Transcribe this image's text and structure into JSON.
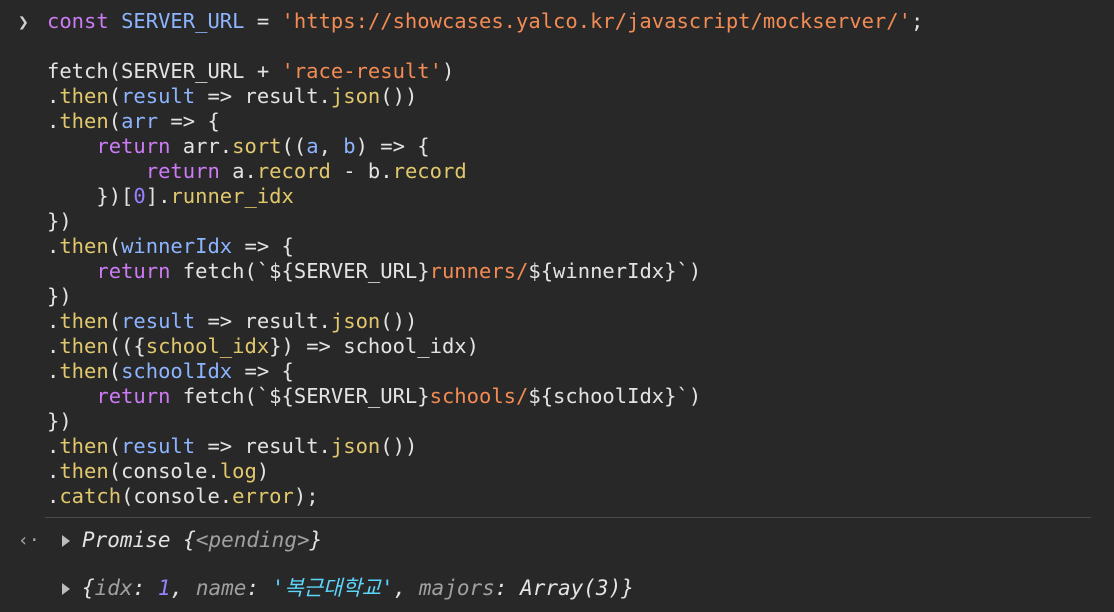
{
  "console": {
    "prompt_icon": "chevron-right-icon",
    "code_lines": [
      [
        {
          "t": "const",
          "c": "kw"
        },
        {
          "t": " ",
          "c": "plain"
        },
        {
          "t": "SERVER_URL",
          "c": "var"
        },
        {
          "t": " = ",
          "c": "plain"
        },
        {
          "t": "'https://showcases.yalco.kr/javascript/mockserver/'",
          "c": "str"
        },
        {
          "t": ";",
          "c": "plain"
        }
      ],
      [],
      [
        {
          "t": "fetch(SERVER_URL + ",
          "c": "plain"
        },
        {
          "t": "'race-result'",
          "c": "str"
        },
        {
          "t": ")",
          "c": "plain"
        }
      ],
      [
        {
          "t": ".",
          "c": "plain"
        },
        {
          "t": "then",
          "c": "fn"
        },
        {
          "t": "(",
          "c": "plain"
        },
        {
          "t": "result",
          "c": "param"
        },
        {
          "t": " => result.",
          "c": "plain"
        },
        {
          "t": "json",
          "c": "fn"
        },
        {
          "t": "())",
          "c": "plain"
        }
      ],
      [
        {
          "t": ".",
          "c": "plain"
        },
        {
          "t": "then",
          "c": "fn"
        },
        {
          "t": "(",
          "c": "plain"
        },
        {
          "t": "arr",
          "c": "param"
        },
        {
          "t": " => {",
          "c": "plain"
        }
      ],
      [
        {
          "t": "    ",
          "c": "plain"
        },
        {
          "t": "return",
          "c": "kw"
        },
        {
          "t": " arr.",
          "c": "plain"
        },
        {
          "t": "sort",
          "c": "fn"
        },
        {
          "t": "((",
          "c": "plain"
        },
        {
          "t": "a",
          "c": "param"
        },
        {
          "t": ", ",
          "c": "plain"
        },
        {
          "t": "b",
          "c": "param"
        },
        {
          "t": ") => {",
          "c": "plain"
        }
      ],
      [
        {
          "t": "        ",
          "c": "plain"
        },
        {
          "t": "return",
          "c": "kw"
        },
        {
          "t": " a.",
          "c": "plain"
        },
        {
          "t": "record",
          "c": "fn"
        },
        {
          "t": " - b.",
          "c": "plain"
        },
        {
          "t": "record",
          "c": "fn"
        }
      ],
      [
        {
          "t": "    })[",
          "c": "plain"
        },
        {
          "t": "0",
          "c": "num"
        },
        {
          "t": "].",
          "c": "plain"
        },
        {
          "t": "runner_idx",
          "c": "fn"
        }
      ],
      [
        {
          "t": "})",
          "c": "plain"
        }
      ],
      [
        {
          "t": ".",
          "c": "plain"
        },
        {
          "t": "then",
          "c": "fn"
        },
        {
          "t": "(",
          "c": "plain"
        },
        {
          "t": "winnerIdx",
          "c": "param"
        },
        {
          "t": " => {",
          "c": "plain"
        }
      ],
      [
        {
          "t": "    ",
          "c": "plain"
        },
        {
          "t": "return",
          "c": "kw"
        },
        {
          "t": " fetch(`${SERVER_URL}",
          "c": "plain"
        },
        {
          "t": "runners/",
          "c": "str"
        },
        {
          "t": "${winnerIdx}`)",
          "c": "plain"
        }
      ],
      [
        {
          "t": "})",
          "c": "plain"
        }
      ],
      [
        {
          "t": ".",
          "c": "plain"
        },
        {
          "t": "then",
          "c": "fn"
        },
        {
          "t": "(",
          "c": "plain"
        },
        {
          "t": "result",
          "c": "param"
        },
        {
          "t": " => result.",
          "c": "plain"
        },
        {
          "t": "json",
          "c": "fn"
        },
        {
          "t": "())",
          "c": "plain"
        }
      ],
      [
        {
          "t": ".",
          "c": "plain"
        },
        {
          "t": "then",
          "c": "fn"
        },
        {
          "t": "(({",
          "c": "plain"
        },
        {
          "t": "school_idx",
          "c": "fn"
        },
        {
          "t": "}) => school_idx)",
          "c": "plain"
        }
      ],
      [
        {
          "t": ".",
          "c": "plain"
        },
        {
          "t": "then",
          "c": "fn"
        },
        {
          "t": "(",
          "c": "plain"
        },
        {
          "t": "schoolIdx",
          "c": "param"
        },
        {
          "t": " => {",
          "c": "plain"
        }
      ],
      [
        {
          "t": "    ",
          "c": "plain"
        },
        {
          "t": "return",
          "c": "kw"
        },
        {
          "t": " fetch(`${SERVER_URL}",
          "c": "plain"
        },
        {
          "t": "schools/",
          "c": "str"
        },
        {
          "t": "${schoolIdx}`)",
          "c": "plain"
        }
      ],
      [
        {
          "t": "})",
          "c": "plain"
        }
      ],
      [
        {
          "t": ".",
          "c": "plain"
        },
        {
          "t": "then",
          "c": "fn"
        },
        {
          "t": "(",
          "c": "plain"
        },
        {
          "t": "result",
          "c": "param"
        },
        {
          "t": " => result.",
          "c": "plain"
        },
        {
          "t": "json",
          "c": "fn"
        },
        {
          "t": "())",
          "c": "plain"
        }
      ],
      [
        {
          "t": ".",
          "c": "plain"
        },
        {
          "t": "then",
          "c": "fn"
        },
        {
          "t": "(console.",
          "c": "plain"
        },
        {
          "t": "log",
          "c": "fn"
        },
        {
          "t": ")",
          "c": "plain"
        }
      ],
      [
        {
          "t": ".",
          "c": "plain"
        },
        {
          "t": "catch",
          "c": "fn"
        },
        {
          "t": "(console.",
          "c": "plain"
        },
        {
          "t": "error",
          "c": "fn"
        },
        {
          "t": ");",
          "c": "plain"
        }
      ]
    ],
    "return_value": {
      "icon": "return-arrow-icon",
      "label": "Promise",
      "state": "<pending>"
    },
    "log_output": {
      "parts": [
        {
          "t": "{",
          "c": "obj"
        },
        {
          "t": "idx",
          "c": "key"
        },
        {
          "t": ": ",
          "c": "obj"
        },
        {
          "t": "1",
          "c": "num"
        },
        {
          "t": ", ",
          "c": "obj"
        },
        {
          "t": "name",
          "c": "key"
        },
        {
          "t": ": ",
          "c": "obj"
        },
        {
          "t": "'복근대학교'",
          "c": "kstr"
        },
        {
          "t": ", ",
          "c": "obj"
        },
        {
          "t": "majors",
          "c": "key"
        },
        {
          "t": ": ",
          "c": "obj"
        },
        {
          "t": "Array(3)",
          "c": "obj"
        },
        {
          "t": "}",
          "c": "obj"
        }
      ]
    }
  }
}
